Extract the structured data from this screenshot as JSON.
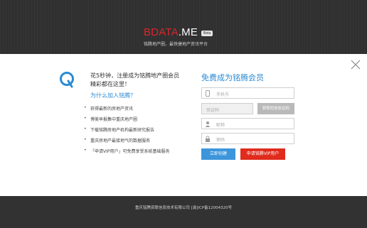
{
  "header": {
    "logo_red": "BDATA",
    "logo_white": ".ME",
    "beta": "Beta",
    "tagline": "铭腾地产圈，最快捷地产资讯平台"
  },
  "promo": {
    "line1": "花5秒钟，注册成为铭腾地产圈会员",
    "line2": "精彩都在这里！",
    "why_link": "为什么加入铭腾？",
    "bullets": [
      "获得最新的房地产资讯",
      "博美早报集中重庆地产圈",
      "下载铭腾房地产机构最新研究报告",
      "重庆房地产最接地气的数据服务",
      "「申请VIP用户」可免费享受系统基础服务"
    ]
  },
  "form": {
    "title": "免费成为铭腾会员",
    "phone_placeholder": "手机号",
    "code_placeholder": "验证码",
    "get_code_label": "获取短信验证码",
    "nickname_placeholder": "昵称",
    "password_placeholder": "密码",
    "create_label": "立即创建",
    "vip_label": "申请铭腾VIP用户"
  },
  "footer": {
    "text": "重庆铭腾资联信息技术有限公司 [渝]ICP备12004320号"
  },
  "colors": {
    "brand_red": "#d9262c",
    "accent_blue": "#2a8ad3",
    "vip_red": "#e02b1d"
  }
}
